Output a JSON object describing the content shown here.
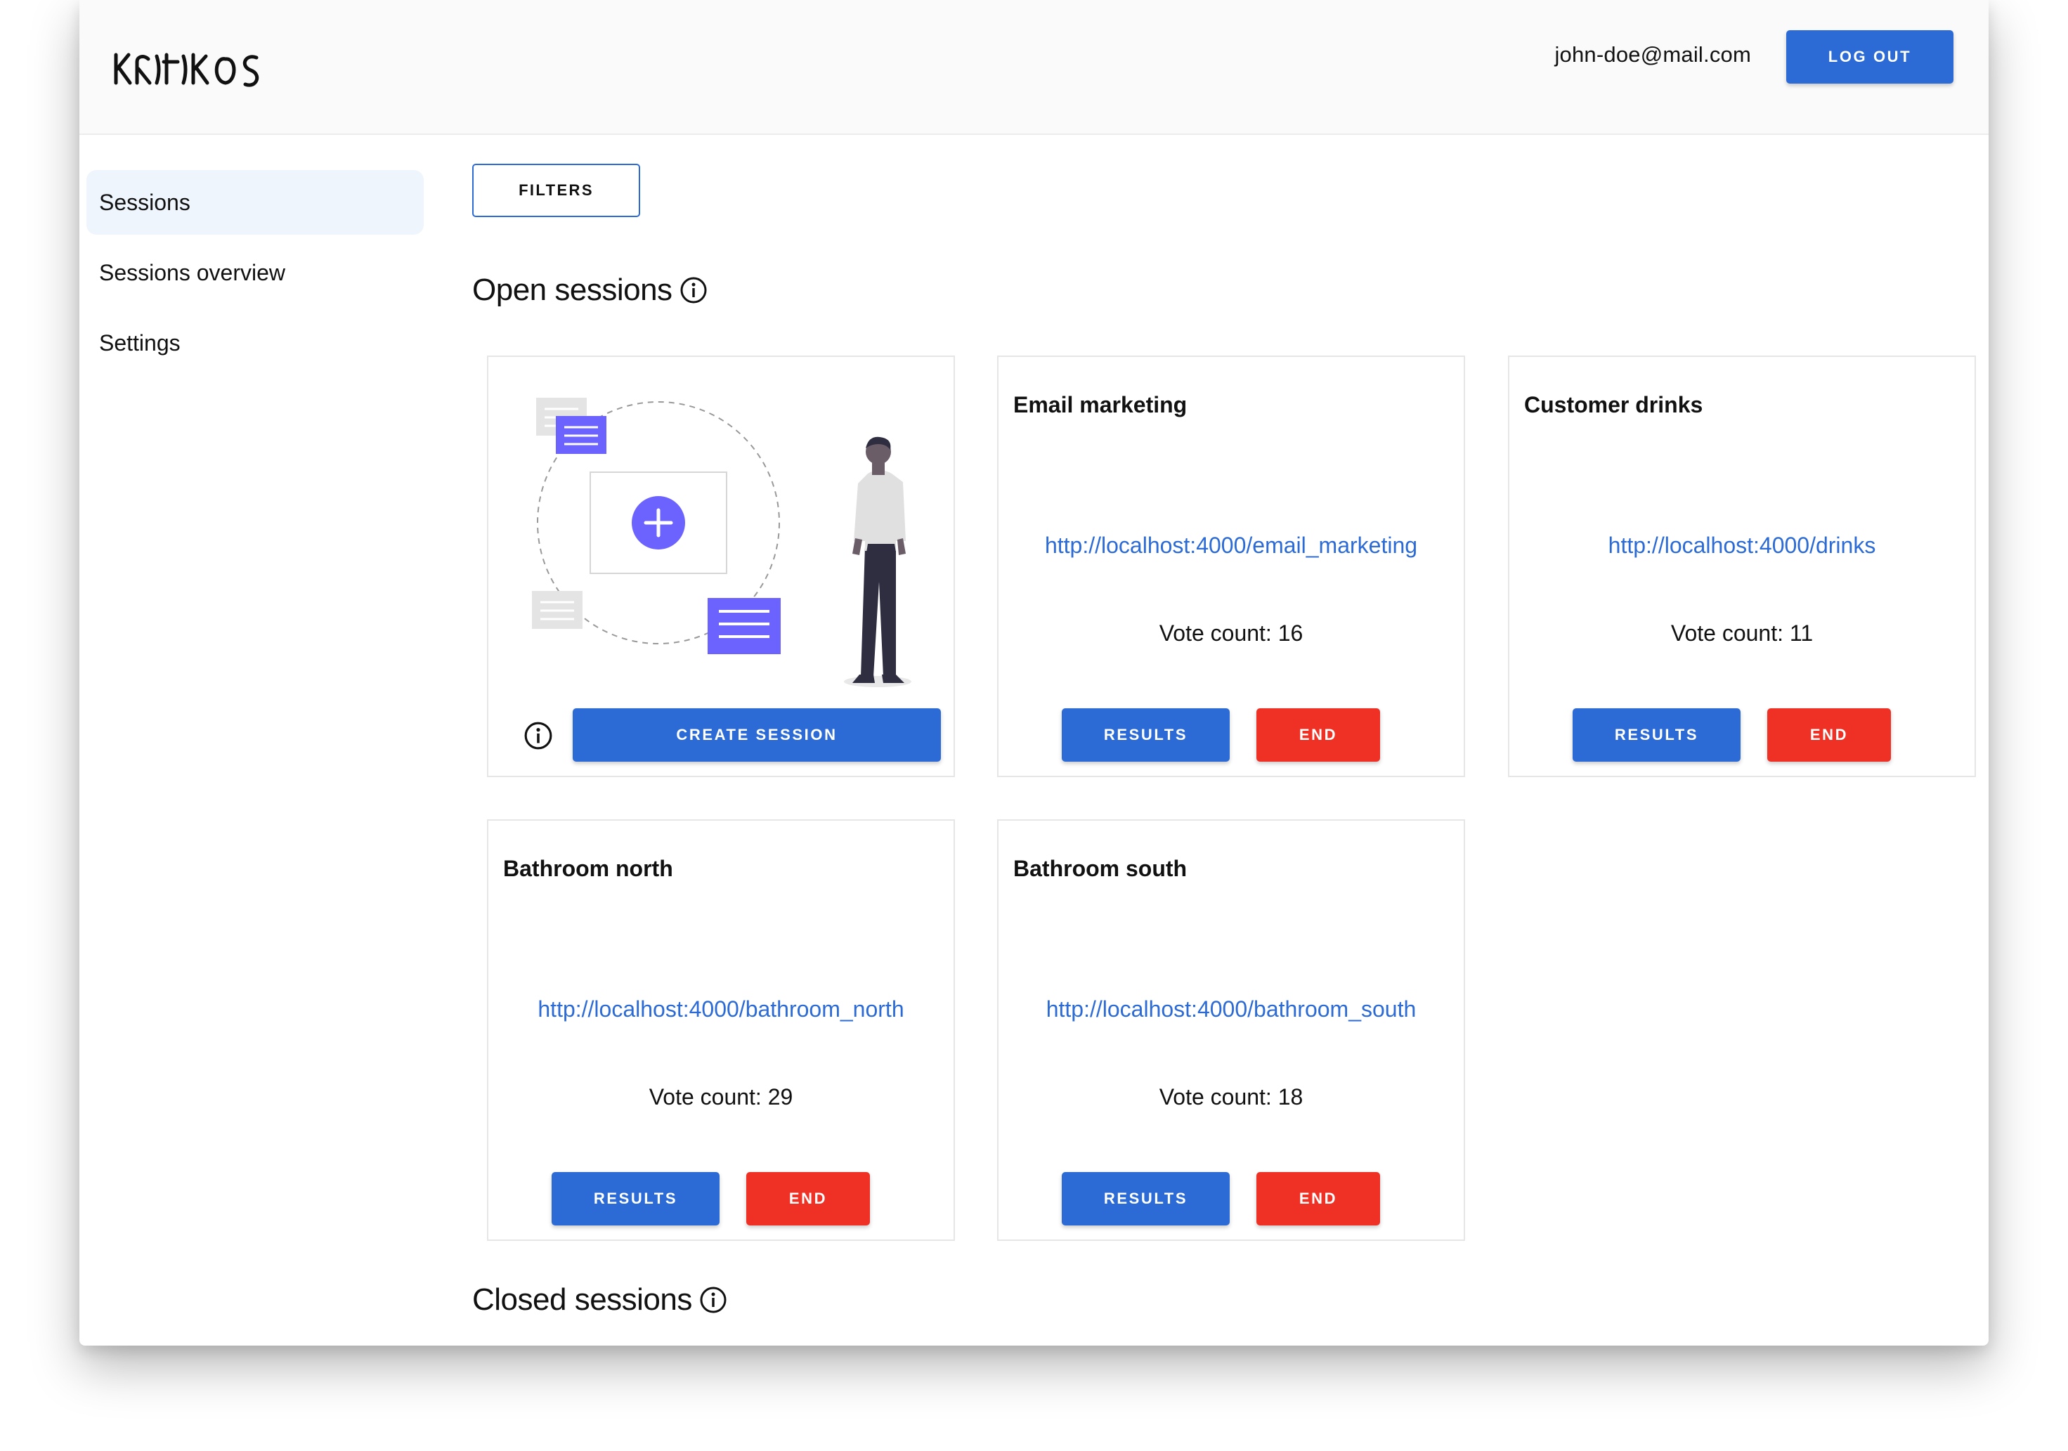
{
  "header": {
    "logo_text": "KRITIKOS",
    "user_email": "john-doe@mail.com",
    "logout_label": "LOG OUT"
  },
  "sidebar": {
    "items": [
      {
        "label": "Sessions",
        "active": true
      },
      {
        "label": "Sessions overview",
        "active": false
      },
      {
        "label": "Settings",
        "active": false
      }
    ]
  },
  "toolbar": {
    "filters_label": "FILTERS"
  },
  "sections": {
    "open_title": "Open sessions",
    "closed_title": "Closed sessions"
  },
  "create_card": {
    "create_label": "CREATE SESSION"
  },
  "sessions": [
    {
      "title": "Email marketing",
      "link": "http://localhost:4000/email_marketing",
      "votes": "Vote count: 16",
      "results_label": "RESULTS",
      "end_label": "END"
    },
    {
      "title": "Customer drinks",
      "link": "http://localhost:4000/drinks",
      "votes": "Vote count: 11",
      "results_label": "RESULTS",
      "end_label": "END"
    },
    {
      "title": "Bathroom north",
      "link": "http://localhost:4000/bathroom_north",
      "votes": "Vote count: 29",
      "results_label": "RESULTS",
      "end_label": "END"
    },
    {
      "title": "Bathroom south",
      "link": "http://localhost:4000/bathroom_south",
      "votes": "Vote count: 18",
      "results_label": "RESULTS",
      "end_label": "END"
    }
  ],
  "colors": {
    "primary": "#2c6bd5",
    "danger": "#ee3124",
    "illustration_accent": "#6c63ff",
    "sidebar_active_bg": "#eff5fd"
  }
}
